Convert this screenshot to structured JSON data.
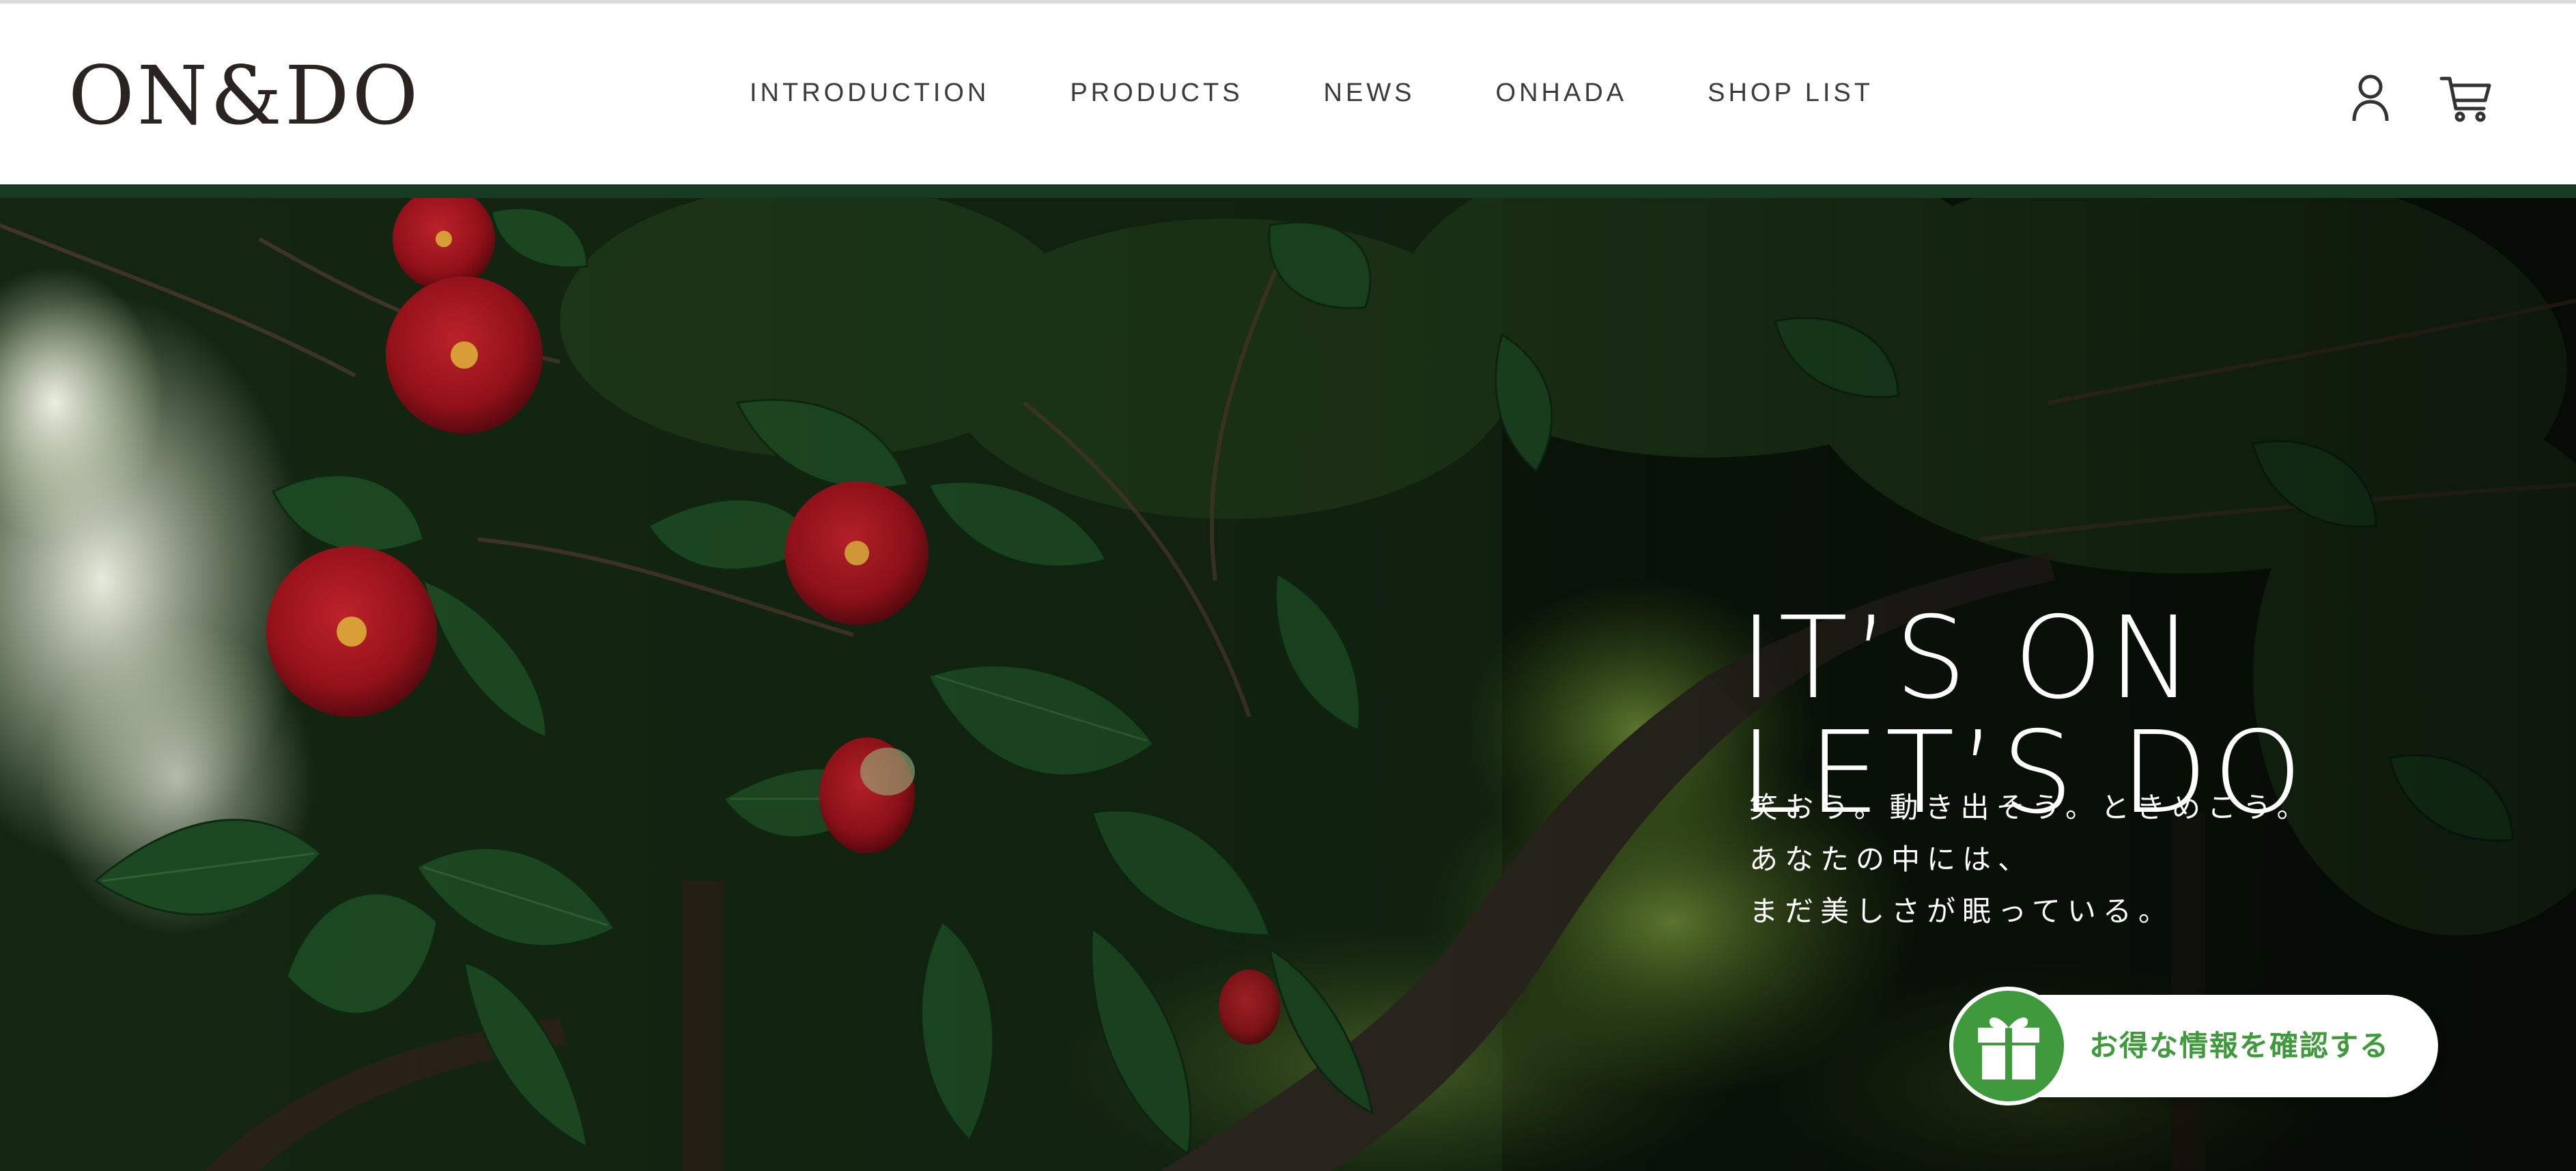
{
  "header": {
    "logo_text": "ON&DO",
    "nav": [
      {
        "label": "INTRODUCTION"
      },
      {
        "label": "PRODUCTS"
      },
      {
        "label": "NEWS"
      },
      {
        "label": "ONHADA"
      },
      {
        "label": "SHOP LIST"
      }
    ],
    "icons": [
      "account-icon",
      "cart-icon"
    ]
  },
  "hero": {
    "headline": [
      "IT’S ON",
      "LET’S DO"
    ],
    "tagline": [
      "笑おう。動き出そう。ときめこう。",
      "あなたの中には、",
      "まだ美しさが眠っている。"
    ],
    "promo_button": {
      "label": "お得な情報を確認する",
      "icon": "gift-icon"
    }
  },
  "colors": {
    "brand_green": "#163b22",
    "promo_green": "#3f9a3b",
    "logo": "#2a2320",
    "nav_text": "#3b3b3b"
  }
}
